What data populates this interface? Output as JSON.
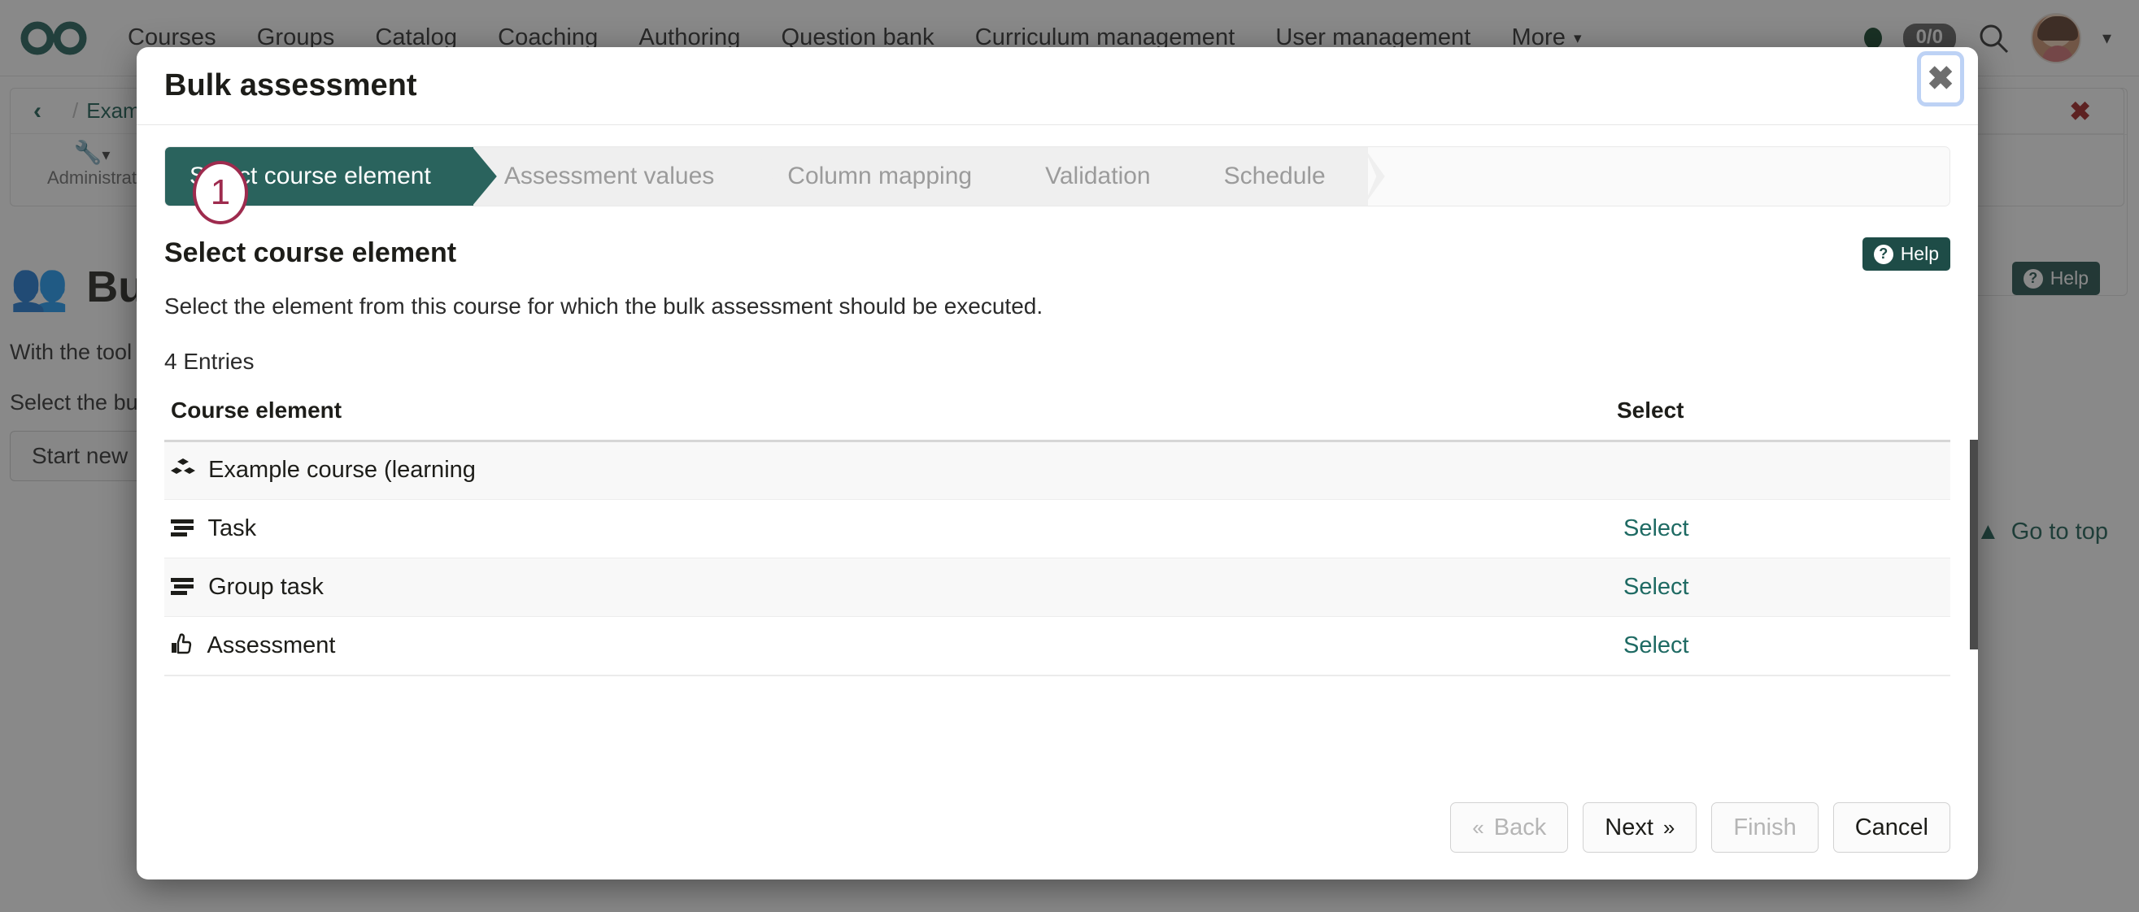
{
  "topnav": {
    "logo_icon": "infinity-logo",
    "links": [
      {
        "label": "Courses"
      },
      {
        "label": "Groups"
      },
      {
        "label": "Catalog"
      },
      {
        "label": "Coaching"
      },
      {
        "label": "Authoring"
      },
      {
        "label": "Question bank"
      },
      {
        "label": "Curriculum management"
      },
      {
        "label": "User management"
      },
      {
        "label": "More"
      }
    ],
    "more_caret": "▾",
    "status_dot": "online-status-dot",
    "counter": "0/0",
    "search_icon": "search-icon",
    "avatar_caret": "▾"
  },
  "background": {
    "breadcrumb": {
      "back_icon": "‹",
      "separator": "/",
      "course_link": "Example"
    },
    "toolbar": {
      "wrench_icon": "wrench-icon",
      "caret": "▾",
      "label": "Administrat"
    },
    "close_x": "✖",
    "page_title": "Bu",
    "page_title_icon": "users-group-icon",
    "paragraph_1": "With the tool",
    "paragraph_2": "Select the bu",
    "start_button": "Start new",
    "help_badge": "Help",
    "help_icon": "question-circle-icon",
    "go_to_top": "Go to top",
    "go_to_top_icon": "chevron-up-icon"
  },
  "modal": {
    "title": "Bulk assessment",
    "close_icon": "close-icon",
    "annotation_badge": "1",
    "steps": [
      {
        "label": "Select course element",
        "active": true
      },
      {
        "label": "Assessment values",
        "active": false
      },
      {
        "label": "Column mapping",
        "active": false
      },
      {
        "label": "Validation",
        "active": false
      },
      {
        "label": "Schedule",
        "active": false
      }
    ],
    "section": {
      "title": "Select course element",
      "help_label": "Help",
      "help_icon": "question-circle-icon",
      "description": "Select the element from this course for which the bulk assessment should be executed.",
      "entries_count": "4 Entries"
    },
    "table": {
      "columns": [
        "Course element",
        "Select"
      ],
      "rows": [
        {
          "icon": "cubes-icon",
          "icon_glyph": "❖",
          "name": "Example course (learning",
          "select": ""
        },
        {
          "icon": "task-list-icon",
          "icon_glyph": "☰",
          "name": "Task",
          "select": "Select"
        },
        {
          "icon": "task-list-icon",
          "icon_glyph": "☰",
          "name": "Group task",
          "select": "Select"
        },
        {
          "icon": "thumbs-up-icon",
          "icon_glyph": "👍",
          "name": "Assessment",
          "select": "Select"
        }
      ]
    },
    "footer": {
      "back": {
        "label": "Back",
        "chev": "«",
        "disabled": true
      },
      "next": {
        "label": "Next",
        "chev": "»",
        "disabled": false
      },
      "finish": {
        "label": "Finish",
        "disabled": true
      },
      "cancel": {
        "label": "Cancel",
        "disabled": false
      }
    }
  },
  "colors": {
    "accent_teal": "#2a635d",
    "link_teal": "#1e6a63",
    "help_badge": "#1e4c47",
    "annotation": "#9e2b4e",
    "danger_red": "#9e1b1b"
  }
}
